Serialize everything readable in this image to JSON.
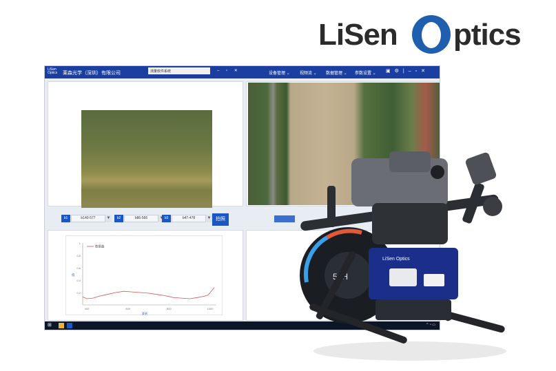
{
  "brand": {
    "logo_part1": "LiSen",
    "logo_part2": "ptics",
    "color": "#1f5fae"
  },
  "titlebar": {
    "logo_text": "LiSen\nOptics",
    "company": "莱森光学（深圳）有限公司",
    "tab": "测量软件系统",
    "menu": [
      {
        "label": "设备管理"
      },
      {
        "label": "视频流"
      },
      {
        "label": "数据管理"
      },
      {
        "label": "参数设置"
      }
    ]
  },
  "bands": [
    {
      "label": "b1",
      "value": "b140-577"
    },
    {
      "label": "b2",
      "value": "b86-566"
    },
    {
      "label": "b3",
      "value": "b47-478"
    }
  ],
  "capture_label": "拍照",
  "blue_field_value": "",
  "chart": {
    "legend": "数据曲",
    "ylabel": "值",
    "xlabel": "波长"
  },
  "chart_data": {
    "type": "line",
    "x": [
      380,
      400,
      430,
      460,
      500,
      540,
      580,
      620,
      660,
      700,
      740,
      780,
      820,
      860,
      900,
      940,
      970,
      990,
      1000,
      1010,
      1020
    ],
    "series": [
      {
        "name": "数据曲",
        "values": [
          0.13,
          0.1,
          0.11,
          0.14,
          0.17,
          0.2,
          0.22,
          0.21,
          0.2,
          0.19,
          0.17,
          0.15,
          0.12,
          0.11,
          0.1,
          0.12,
          0.14,
          0.16,
          0.2,
          0.24,
          0.28
        ]
      }
    ],
    "xlim": [
      380,
      1030
    ],
    "ylim": [
      0,
      1
    ],
    "x_ticks": [
      400,
      600,
      800,
      1000
    ],
    "y_ticks": [
      0.2,
      0.4,
      0.6,
      0.8,
      1.0
    ],
    "color": "#d9534f",
    "legend_position": "top-left"
  },
  "gimbal_badge": "51H",
  "drone_payload": {
    "color": "#1b2f8a",
    "label": "LiSen Optics"
  }
}
